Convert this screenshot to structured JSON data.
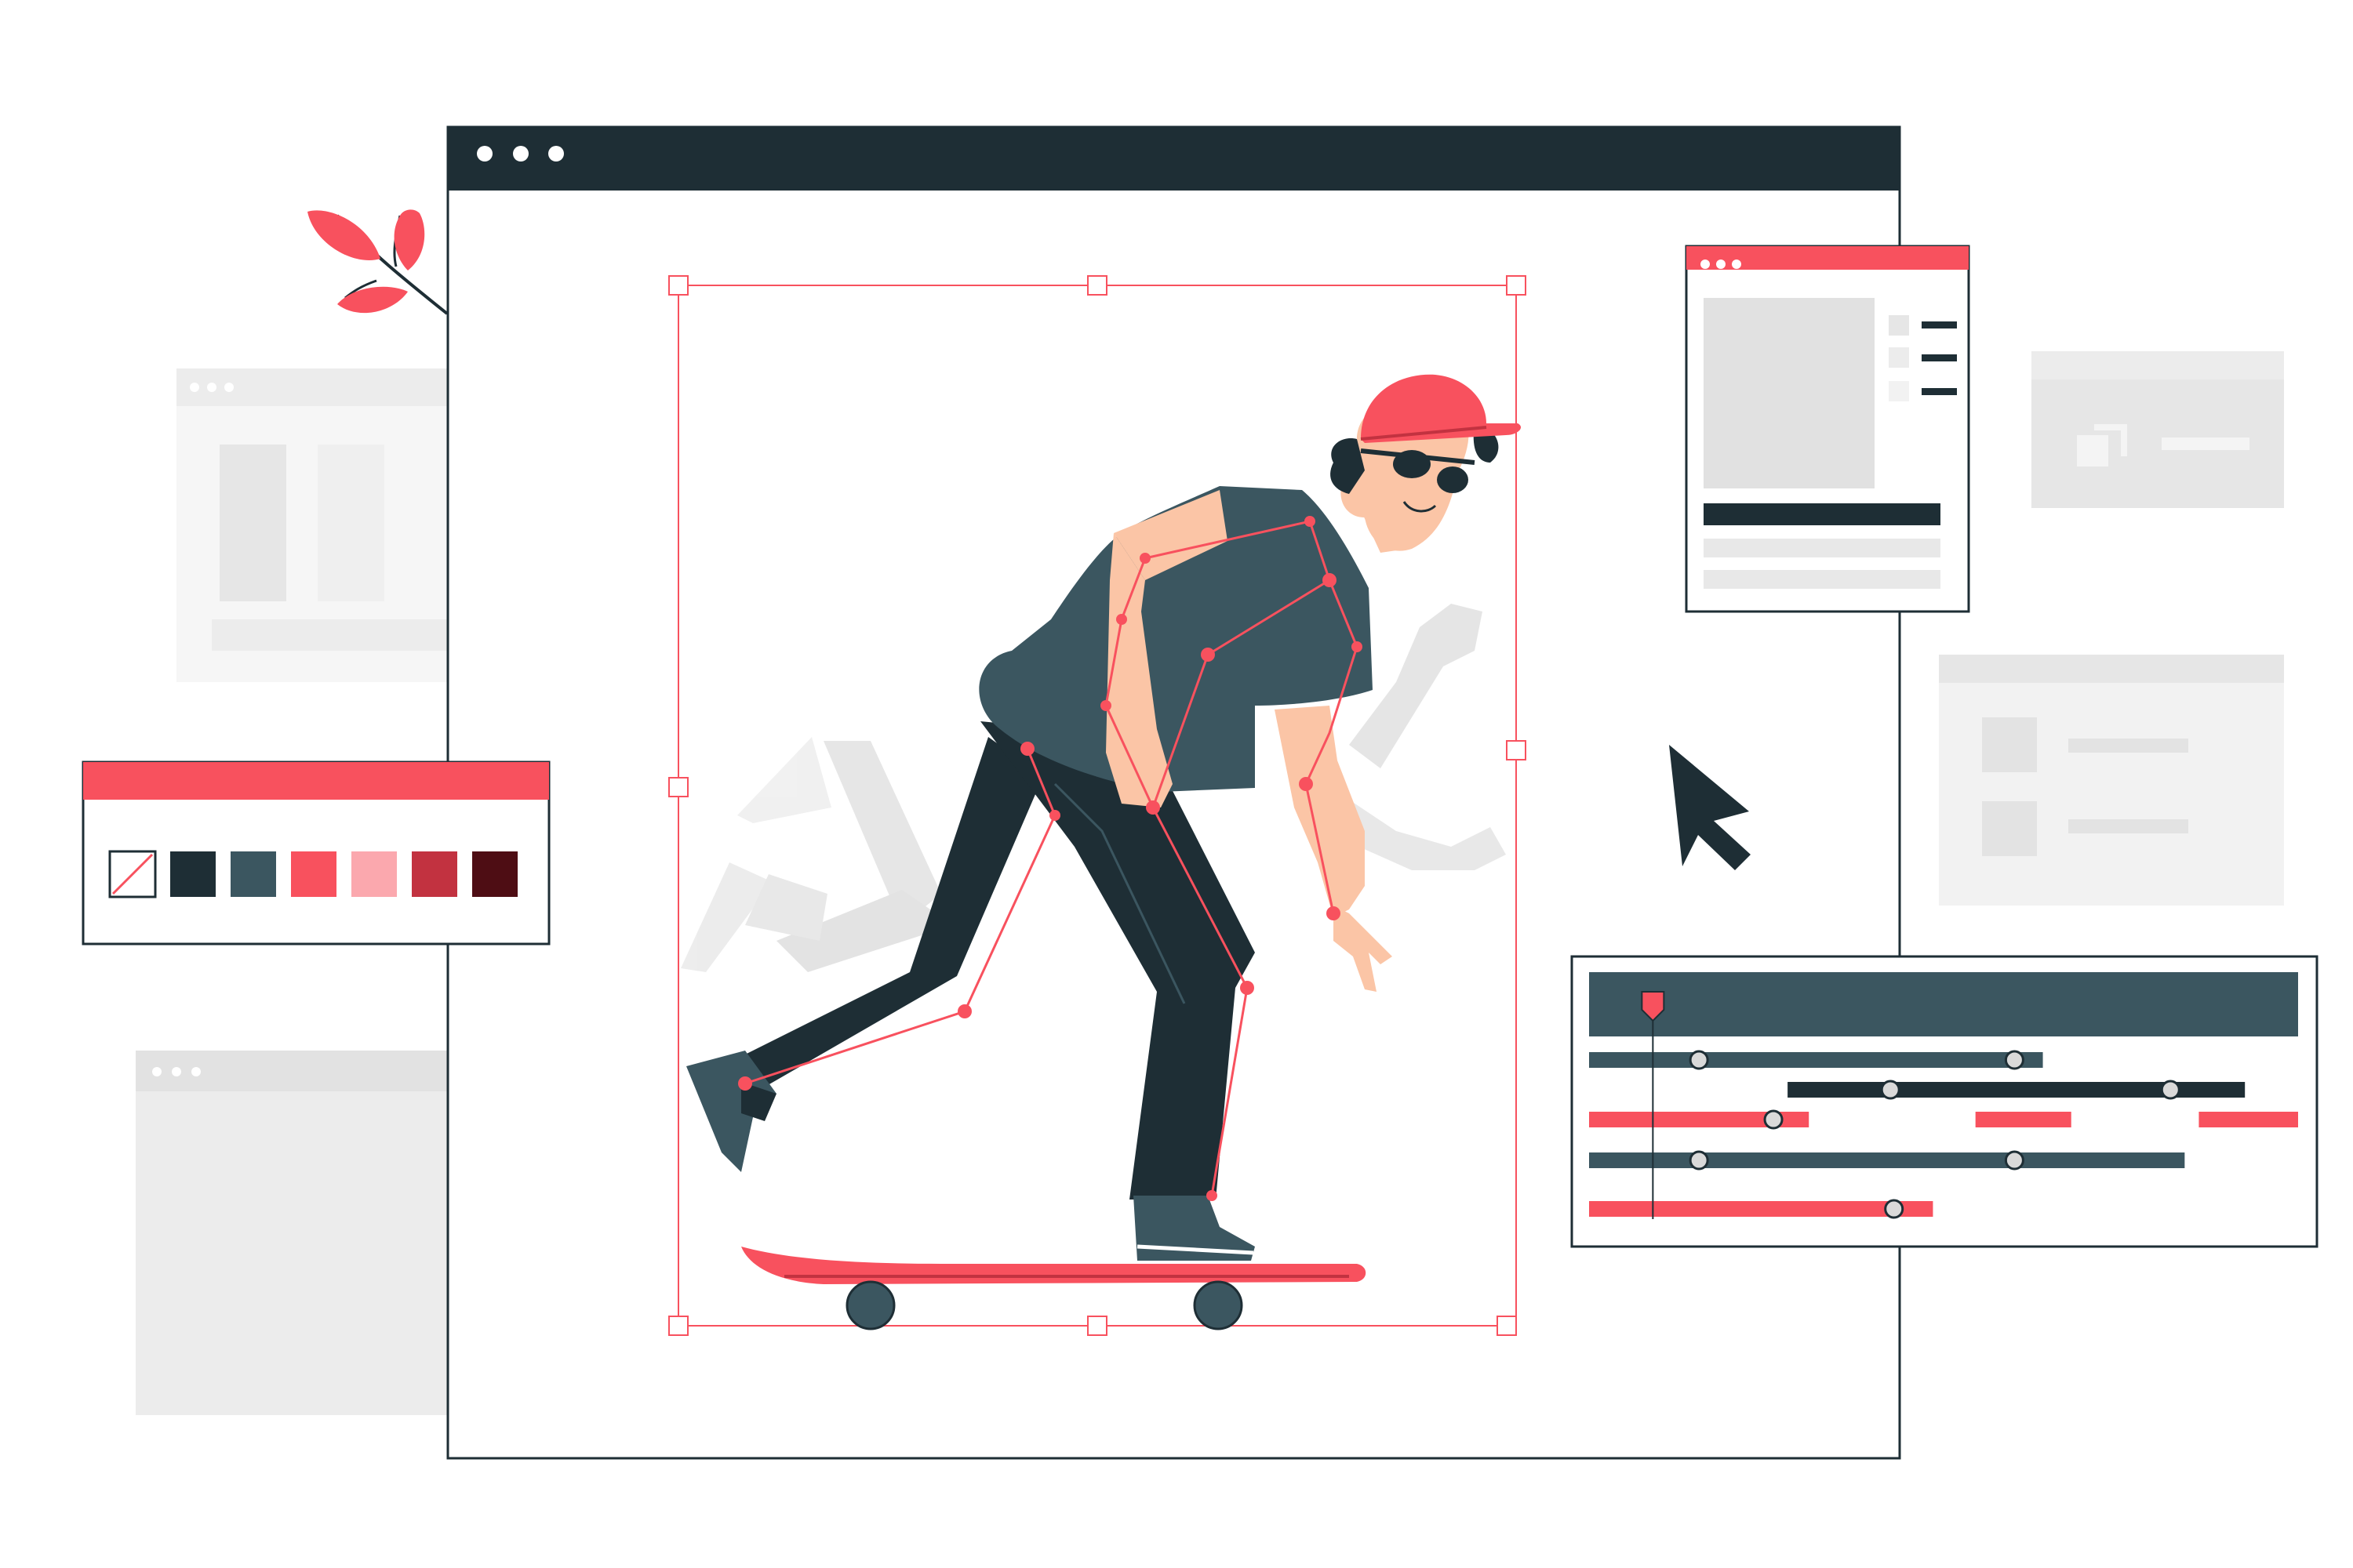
{
  "palette": {
    "dark": "#1e2e35",
    "slate": "#3b5660",
    "red": "#f8515e",
    "pink": "#fba8ae",
    "crimson": "#c23240",
    "maroon": "#4e0d14",
    "skin": "#fbc5a6",
    "ghost": "#e8e8e8",
    "ghost_dark": "#dcdcdc",
    "panel_grey": "#ececec"
  },
  "color_swatches": [
    {
      "name": "none",
      "color": "none"
    },
    {
      "name": "dark",
      "color": "#1e2e35"
    },
    {
      "name": "slate",
      "color": "#3b5660"
    },
    {
      "name": "red",
      "color": "#f8515e"
    },
    {
      "name": "pink",
      "color": "#fba8ae"
    },
    {
      "name": "crimson",
      "color": "#c23240"
    },
    {
      "name": "maroon",
      "color": "#4e0d14"
    }
  ],
  "timeline_tracks": [
    {
      "color": "#3b5660",
      "segments": [
        [
          0.0,
          0.64
        ]
      ],
      "keyframes": [
        0.155,
        0.6
      ]
    },
    {
      "color": "#1e2e35",
      "segments": [
        [
          0.28,
          0.925
        ]
      ],
      "keyframes": [
        0.425,
        0.82
      ]
    },
    {
      "color": "#f8515e",
      "segments": [
        [
          0.0,
          0.31
        ],
        [
          0.545,
          0.68
        ],
        [
          0.86,
          1.0
        ]
      ],
      "keyframes": [
        0.26
      ]
    },
    {
      "color": "#3b5660",
      "segments": [
        [
          0.0,
          0.84
        ]
      ],
      "keyframes": [
        0.155,
        0.6
      ]
    },
    {
      "color": "#f8515e",
      "segments": [
        [
          0.0,
          0.485
        ]
      ],
      "keyframes": [
        0.43
      ]
    }
  ],
  "playhead_position": 0.09,
  "icons": {
    "cursor": "mouse-pointer-icon",
    "leaf": "leaf-branch-icon",
    "window_dots": "window-control-dots-icon",
    "copy": "duplicate-icon",
    "playhead": "playhead-marker-icon",
    "keyframe": "keyframe-dot-icon"
  }
}
